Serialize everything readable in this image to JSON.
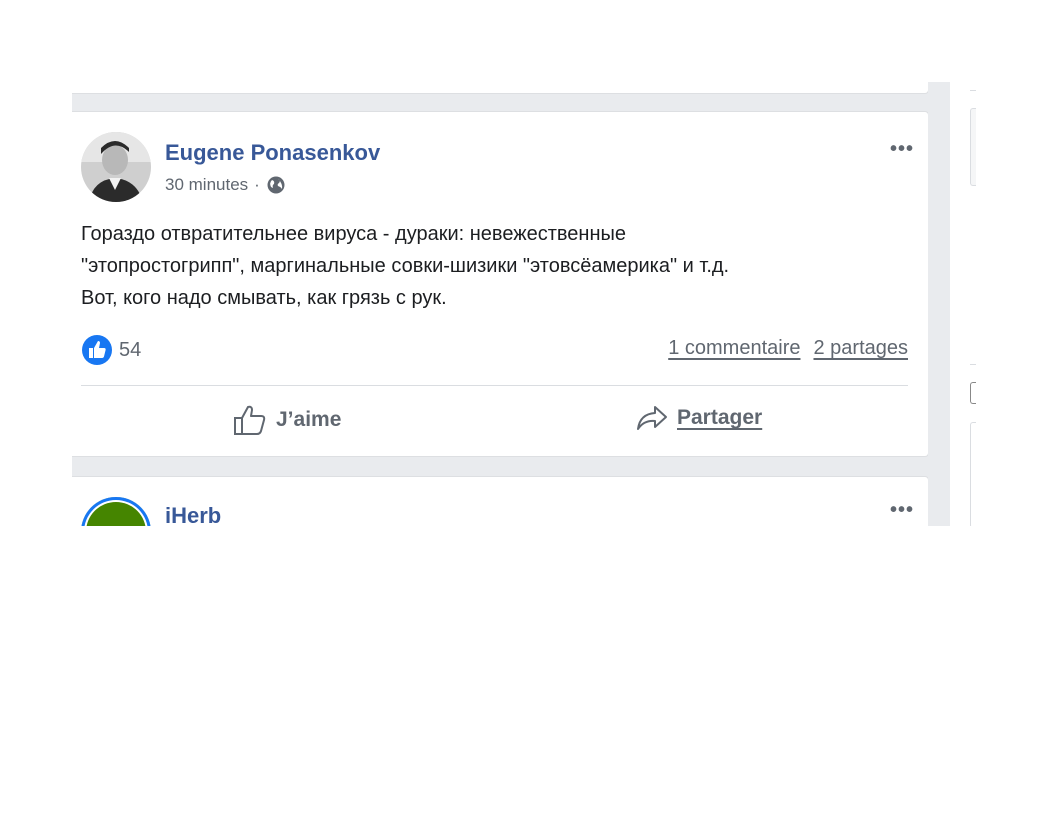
{
  "post1": {
    "author": "Eugene Ponasenkov",
    "time": "30 minutes",
    "separator": "·",
    "privacy_icon": "globe-icon",
    "text": [
      "Гораздо отвратительнее вируса - дураки: невежественные",
      "\"этопростогрипп\", маргинальные совки-шизики \"этовсёамерика\" и т.д.",
      "Вот, кого надо смывать, как грязь с рук."
    ],
    "reaction_icon": "like-reaction-icon",
    "reaction_count": "54",
    "comments": "1 commentaire",
    "shares": "2 partages",
    "like_label": "J’aime",
    "share_label": "Partager"
  },
  "post2": {
    "author": "iHerb"
  },
  "menu_label": "•••",
  "colors": {
    "author_blue": "#385898",
    "like_blue": "#1877f2",
    "feed_bg": "#e9ebee",
    "secondary_text": "#606770",
    "iherb_green": "#458500"
  }
}
